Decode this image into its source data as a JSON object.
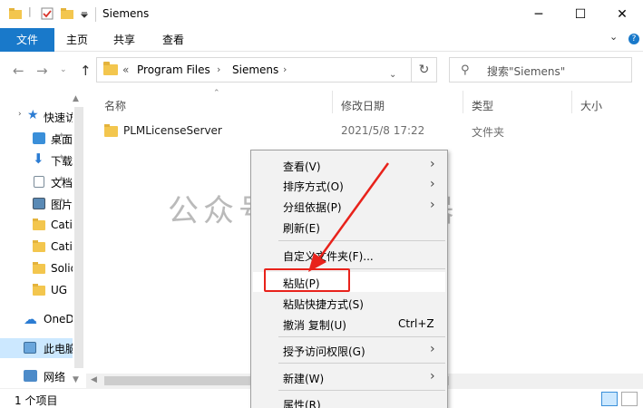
{
  "window": {
    "title": "Siemens",
    "minimize_glyph": "─",
    "maximize_glyph": "☐",
    "close_glyph": "✕"
  },
  "ribbon": {
    "tabs": [
      "文件",
      "主页",
      "共享",
      "查看"
    ],
    "expand_glyph": "⌄",
    "help_glyph": "?"
  },
  "address": {
    "overflow": "«",
    "segments": [
      "Program Files",
      "Siemens"
    ],
    "chevron": "›"
  },
  "search": {
    "placeholder": "搜索\"Siemens\""
  },
  "nav_pane": {
    "items": [
      {
        "label": "快速访问",
        "icon": "star-icon"
      },
      {
        "label": "桌面",
        "icon": "desktop-icon"
      },
      {
        "label": "下载",
        "icon": "download-icon"
      },
      {
        "label": "文档",
        "icon": "document-icon"
      },
      {
        "label": "图片",
        "icon": "picture-icon"
      },
      {
        "label": "Catia",
        "icon": "folder-icon"
      },
      {
        "label": "Catia",
        "icon": "folder-icon"
      },
      {
        "label": "Solid",
        "icon": "folder-icon"
      },
      {
        "label": "UG",
        "icon": "folder-icon"
      },
      {
        "label": "OneDrive",
        "icon": "cloud-icon"
      },
      {
        "label": "此电脑",
        "icon": "computer-icon"
      },
      {
        "label": "网络",
        "icon": "network-icon"
      }
    ]
  },
  "columns": [
    "名称",
    "修改日期",
    "类型",
    "大小"
  ],
  "files": [
    {
      "name": "PLMLicenseServer",
      "modified": "2021/5/8 17:22",
      "type": "文件夹",
      "size": ""
    }
  ],
  "status": {
    "count": "1 个项目"
  },
  "context_menu": {
    "items": [
      {
        "label": "查看(V)",
        "submenu": true
      },
      {
        "label": "排序方式(O)",
        "submenu": true
      },
      {
        "label": "分组依据(P)",
        "submenu": true
      },
      {
        "label": "刷新(E)"
      },
      {
        "label": "自定义文件夹(F)..."
      },
      {
        "label": "粘贴(P)"
      },
      {
        "label": "粘贴快捷方式(S)"
      },
      {
        "label": "撤消 复制(U)",
        "shortcut": "Ctrl+Z"
      },
      {
        "label": "授予访问权限(G)",
        "submenu": true
      },
      {
        "label": "新建(W)",
        "submenu": true
      },
      {
        "label": "属性(R)"
      }
    ],
    "arrow_glyph": "›"
  },
  "watermark": "公众号 · 开源神器",
  "colors": {
    "accent": "#1979ca",
    "highlight": "#e8221b",
    "folder": "#f3c64e"
  }
}
